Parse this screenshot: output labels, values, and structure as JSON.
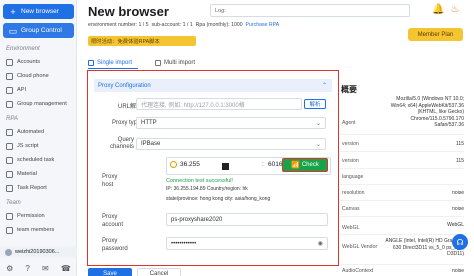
{
  "sidebar": {
    "new_browser": "New browser",
    "group_control": "Group Control",
    "sections": {
      "environment": "Environment",
      "rpa": "RPA",
      "team": "Team"
    },
    "env_items": [
      "Accounts",
      "Cloud phone",
      "API",
      "Group management"
    ],
    "rpa_items": [
      "Automated",
      "JS script",
      "scheduled task",
      "Material",
      "Task Report"
    ],
    "team_items": [
      "Permission",
      "team members"
    ],
    "user": "weizhi20190306..."
  },
  "header": {
    "title": "New browser",
    "log_placeholder": "Log:",
    "stats": {
      "env_label": "environment number: ",
      "env_value": "1 / 5",
      "sub_label": "sub-account: ",
      "sub_value": "1 / 1",
      "rpa_label": "Rpa (monthly): ",
      "rpa_value": "1000",
      "purchase": "Purchase RPA"
    },
    "promo": "限时活动：免费体验RPA脚本",
    "member_center": "Member Plan"
  },
  "tabs": {
    "single": "Single import",
    "multi": "Multi import"
  },
  "proxy": {
    "section_title": "Proxy Configuration",
    "url_label": "URL解析",
    "url_placeholder": "代理连接, 例如: http://127.0.0.1:3000格",
    "parse_button": "解析",
    "type_label": "Proxy type:",
    "type_value": "HTTP",
    "query_label": "Query channels",
    "query_value": "IPBase",
    "host_label": "Proxy host",
    "host_ip": "36.255",
    "port": "6016",
    "check_button": "Check",
    "success_msg": "Connection test successful!",
    "ip_info": "IP: 36.255.194.89 Country/region: hk",
    "location_info": "state/province: hong kong city: asia/hong_kong",
    "account_label": "Proxy account",
    "account_value": "ps-proxyshare2020",
    "password_label": "Proxy password",
    "password_value": "••••••••••••"
  },
  "buttons": {
    "save": "Save",
    "cancel": "Cancel"
  },
  "overview": {
    "title": "概要",
    "rows": [
      {
        "label": "Agent",
        "value": "Mozilla/5.0 (Windows NT 10.0; Win64; x64) AppleWebKit/537.36 (KHTML, like Gecko) Chrome/115.0.5790.170 Safari/537.36"
      },
      {
        "label": "version",
        "value": "115"
      },
      {
        "label": "version",
        "value": "115"
      },
      {
        "label": "language",
        "value": ""
      },
      {
        "label": "resolution",
        "value": "noise"
      },
      {
        "label": "Canvas",
        "value": "noise"
      },
      {
        "label": "WebGL",
        "value": "WebGL"
      },
      {
        "label": "WebGL Vendor",
        "value": "ANGLE (Intel, Intel(R) HD Graphics 630 Direct3D11 vs_5_0 ps_5_0, D3D11)"
      },
      {
        "label": "AudioContext",
        "value": "noise"
      }
    ]
  }
}
